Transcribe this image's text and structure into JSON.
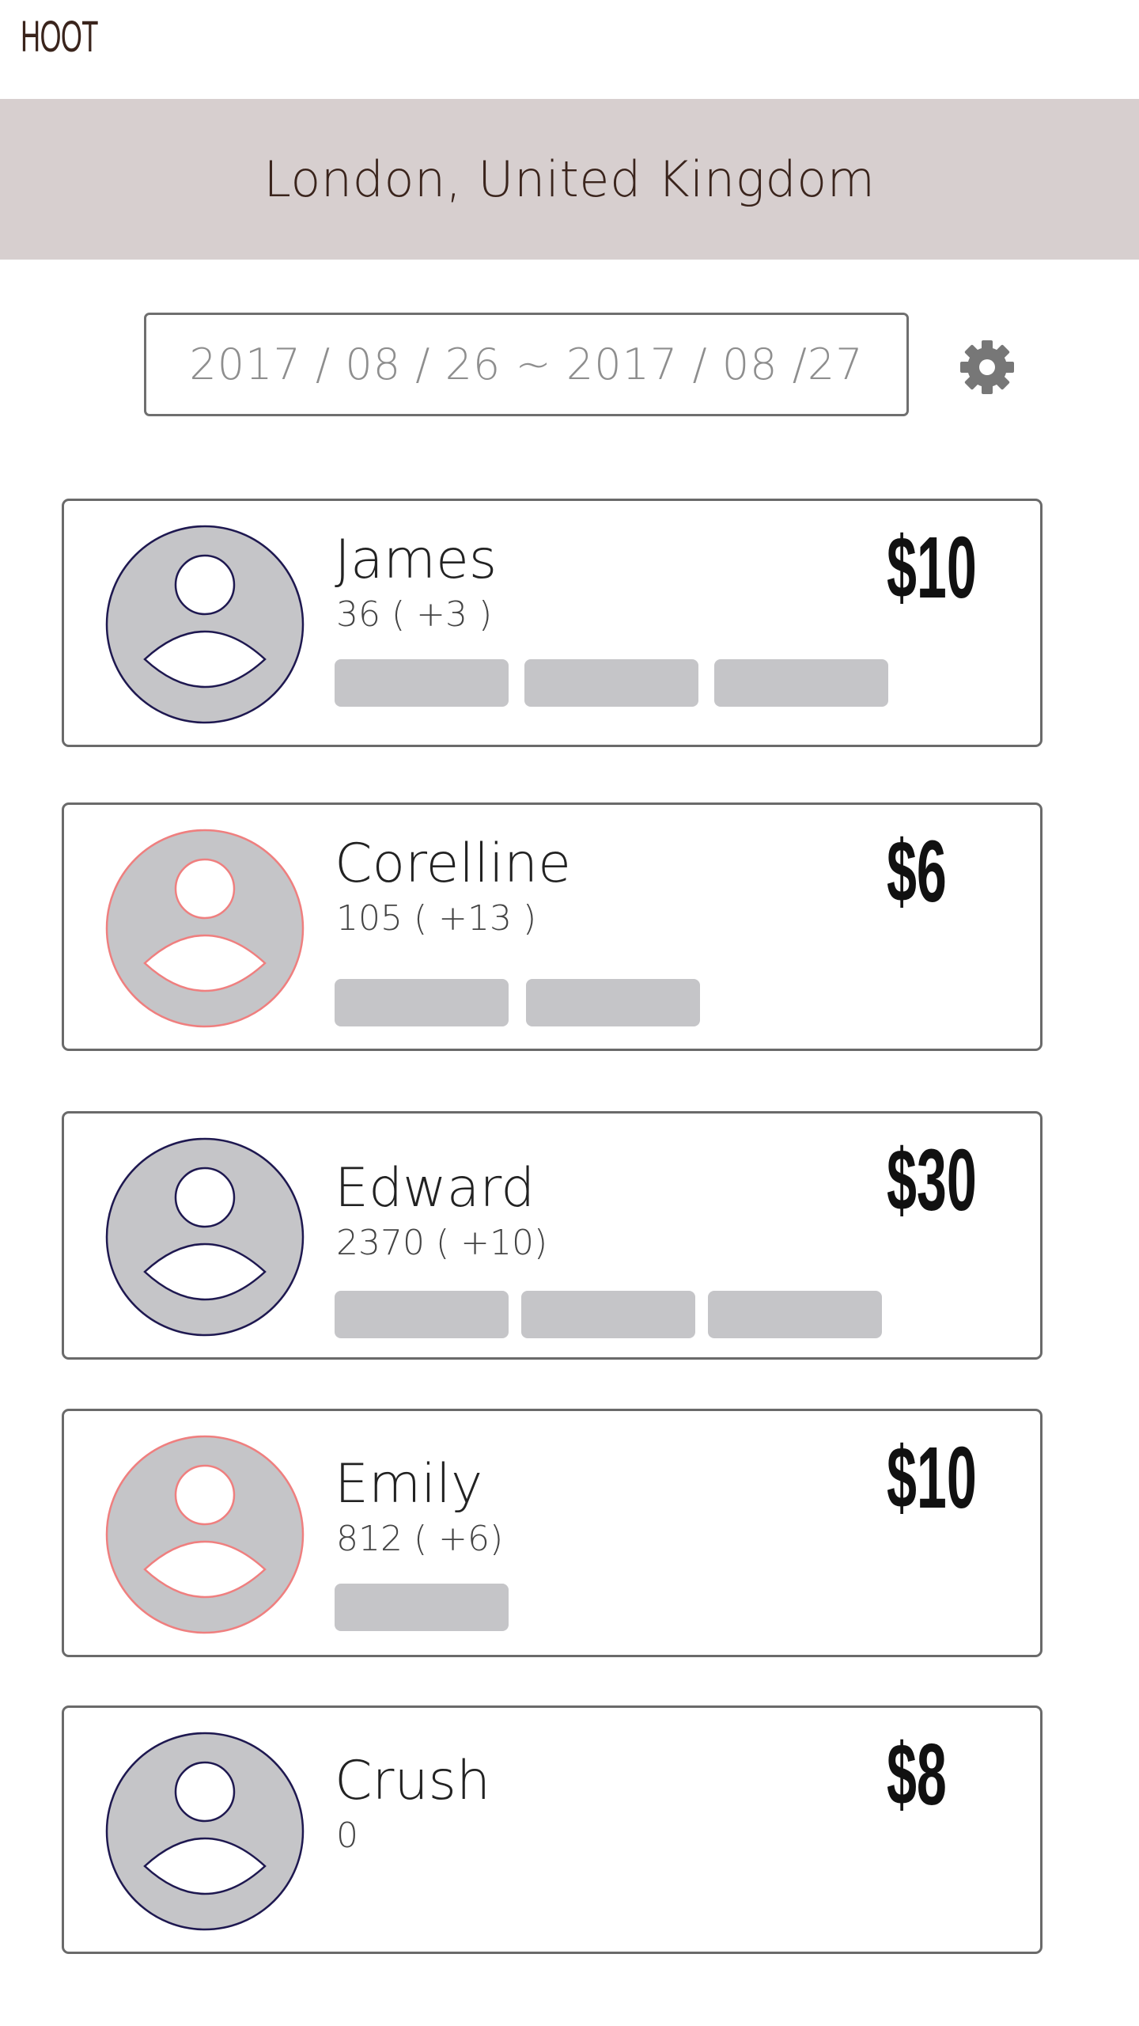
{
  "app": {
    "title": "HOOT"
  },
  "location": {
    "label": "London, United Kingdom"
  },
  "date_range": {
    "value": "2017 / 08 / 26 ~ 2017 / 08 /27"
  },
  "settings": {
    "icon": "gear-icon",
    "color": "#777777"
  },
  "colors": {
    "avatar_fill": "#c5c5c8",
    "avatar_stroke_male": "#1e1850",
    "avatar_stroke_female": "#ef7f7f",
    "banner": "#d7cfcf"
  },
  "profiles": [
    {
      "name": "James",
      "score": "36 ( +3 )",
      "price": "$10",
      "gender": "male",
      "tags": 3
    },
    {
      "name": "Corelline",
      "score": "105 ( +13 )",
      "price": "$6",
      "gender": "female",
      "tags": 2
    },
    {
      "name": "Edward",
      "score": "2370 ( +10)",
      "price": "$30",
      "gender": "male",
      "tags": 3
    },
    {
      "name": "Emily",
      "score": "812 ( +6)",
      "price": "$10",
      "gender": "female",
      "tags": 1
    },
    {
      "name": "Crush",
      "score": "0",
      "price": "$8",
      "gender": "male",
      "tags": 0
    }
  ]
}
